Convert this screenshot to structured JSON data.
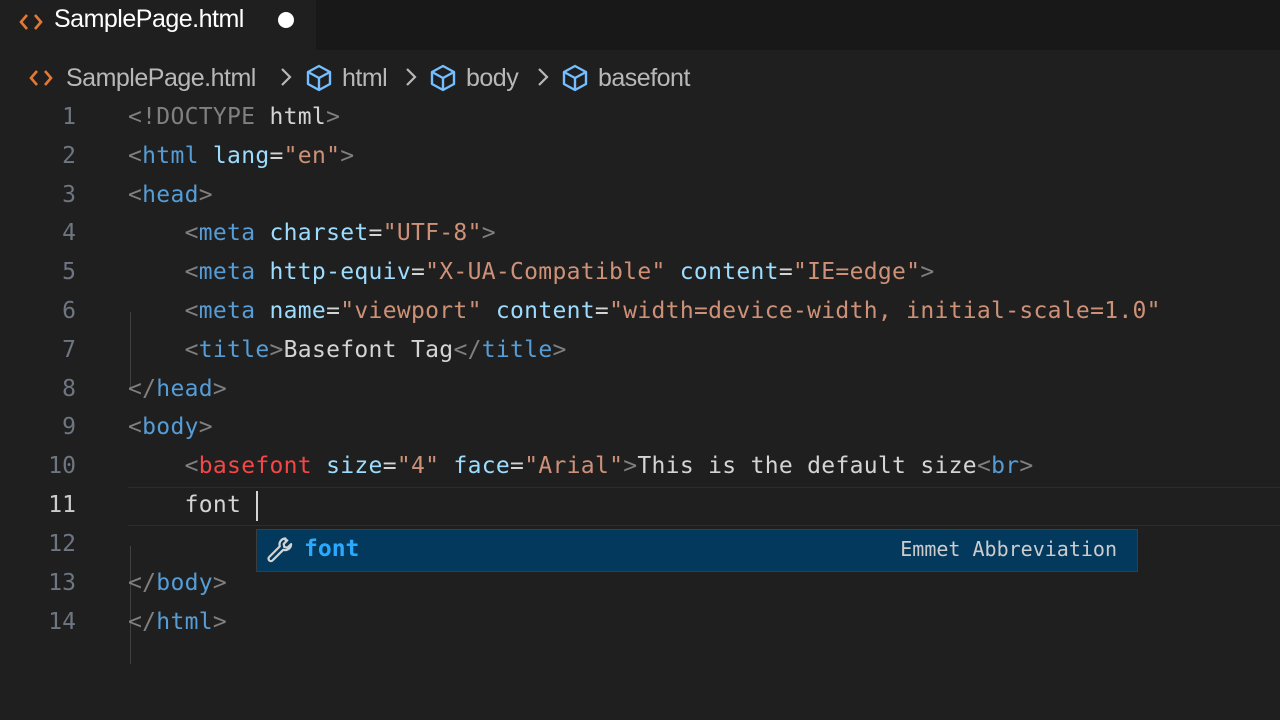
{
  "tab": {
    "filename": "SamplePage.html",
    "modified": true
  },
  "breadcrumb": {
    "file": "SamplePage.html",
    "items": [
      "html",
      "body",
      "basefont"
    ]
  },
  "editor": {
    "active_line": 11,
    "lines": [
      {
        "n": "1"
      },
      {
        "n": "2"
      },
      {
        "n": "3"
      },
      {
        "n": "4"
      },
      {
        "n": "5"
      },
      {
        "n": "6"
      },
      {
        "n": "7"
      },
      {
        "n": "8"
      },
      {
        "n": "9"
      },
      {
        "n": "10"
      },
      {
        "n": "11"
      },
      {
        "n": "12"
      },
      {
        "n": "13"
      },
      {
        "n": "14"
      }
    ],
    "code": {
      "l1": [
        "<!DOCTYPE",
        " html",
        ">"
      ],
      "l2": [
        "<",
        "html",
        " lang",
        "=",
        "\"en\"",
        ">"
      ],
      "l3": [
        "<",
        "head",
        ">"
      ],
      "l4": [
        "    <",
        "meta",
        " charset",
        "=",
        "\"UTF-8\"",
        ">"
      ],
      "l5": [
        "    <",
        "meta",
        " http-equiv",
        "=",
        "\"X-UA-Compatible\"",
        " content",
        "=",
        "\"IE=edge\"",
        ">"
      ],
      "l6": [
        "    <",
        "meta",
        " name",
        "=",
        "\"viewport\"",
        " content",
        "=",
        "\"width=device-width, initial-scale=1.0\""
      ],
      "l7": [
        "    <",
        "title",
        ">",
        "Basefont Tag",
        "</",
        "title",
        ">"
      ],
      "l8": [
        "</",
        "head",
        ">"
      ],
      "l9": [
        "<",
        "body",
        ">"
      ],
      "l10": [
        "    <",
        "basefont",
        " size",
        "=",
        "\"4\"",
        " face",
        "=",
        "\"Arial\"",
        ">",
        "This is the default size",
        "<",
        "br",
        ">"
      ],
      "l11": [
        "    font"
      ],
      "l13": [
        "</",
        "body",
        ">"
      ],
      "l14": [
        "</",
        "html",
        ">"
      ]
    }
  },
  "suggestion": {
    "label": "font",
    "detail": "Emmet Abbreviation",
    "icon": "wrench-icon"
  },
  "colors": {
    "tag": "#569cd6",
    "attribute": "#9cdcfe",
    "string": "#ce9178",
    "suggest_highlight": "#04395e"
  }
}
